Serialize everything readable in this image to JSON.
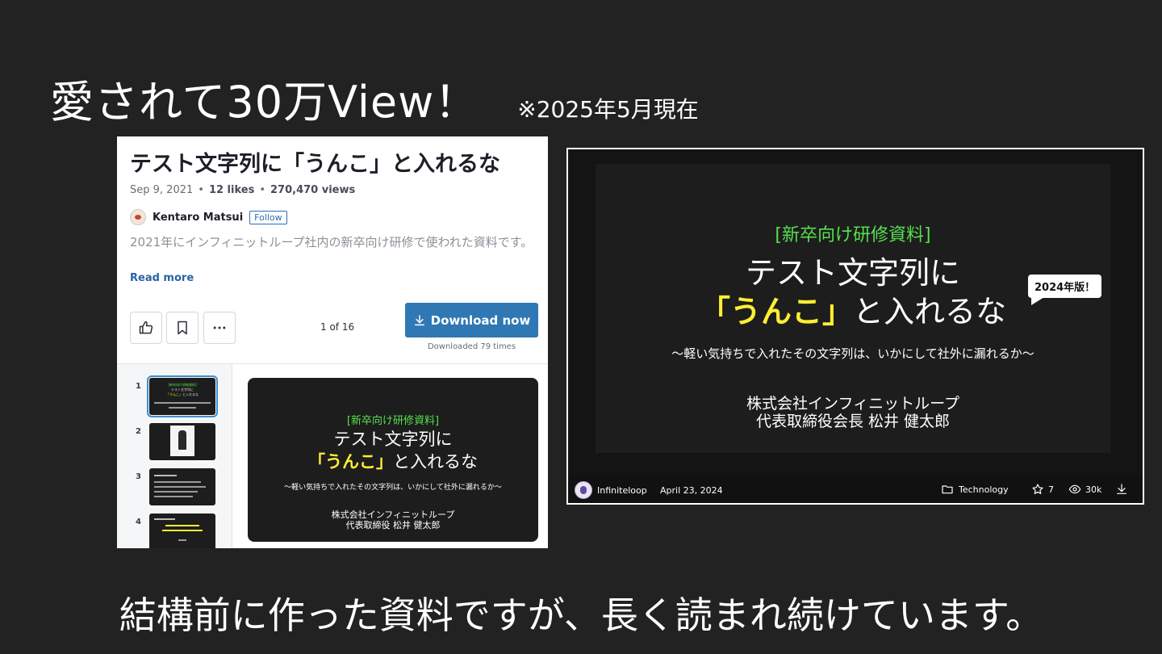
{
  "headline": "愛されて30万View！",
  "headline_note": "※2025年5月現在",
  "footer_caption": "結構前に作った資料ですが、長く読まれ続けています。",
  "left_panel": {
    "title": "テスト文字列に「うんこ」と入れるな",
    "date": "Sep 9, 2021",
    "likes": "12 likes",
    "views": "270,470 views",
    "author": "Kentaro Matsui",
    "follow_label": "Follow",
    "description": "2021年にインフィニットループ社内の新卒向け研修で使われた資料です。",
    "read_more": "Read more",
    "page_count": "1 of 16",
    "download_label": "Download now",
    "downloaded_count": "Downloaded 79 times",
    "thumbnails": [
      {
        "num": "1"
      },
      {
        "num": "2"
      },
      {
        "num": "3"
      },
      {
        "num": "4"
      }
    ],
    "slide": {
      "tag": "[新卒向け研修資料]",
      "title_line1": "テスト文字列に",
      "title_quote": "「うんこ」",
      "title_rest": "と入れるな",
      "subtitle": "～軽い気持ちで入れたその文字列は、いかにして社外に漏れるか～",
      "company": "株式会社インフィニットループ",
      "presenter": "代表取締役 松井 健太郎"
    }
  },
  "right_panel": {
    "slide": {
      "tag": "[新卒向け研修資料]",
      "title_line1": "テスト文字列に",
      "title_quote": "「うんこ」",
      "title_rest": "と入れるな",
      "badge": "2024年版！",
      "subtitle": "～軽い気持ちで入れたその文字列は、いかにして社外に漏れるか～",
      "company": "株式会社インフィニットループ",
      "presenter": "代表取締役会長 松井 健太郎"
    },
    "author": "Infiniteloop",
    "date": "April 23, 2024",
    "category": "Technology",
    "stars": "7",
    "views": "30k"
  },
  "colors": {
    "background": "#222222",
    "slide_green": "#57e04e",
    "slide_yellow": "#ffee33",
    "download_blue": "#2f78b4",
    "link_blue": "#2a63a6"
  },
  "icons": [
    "thumbs-up-icon",
    "bookmark-icon",
    "more-icon",
    "download-icon",
    "folder-icon",
    "star-icon",
    "eye-icon"
  ]
}
